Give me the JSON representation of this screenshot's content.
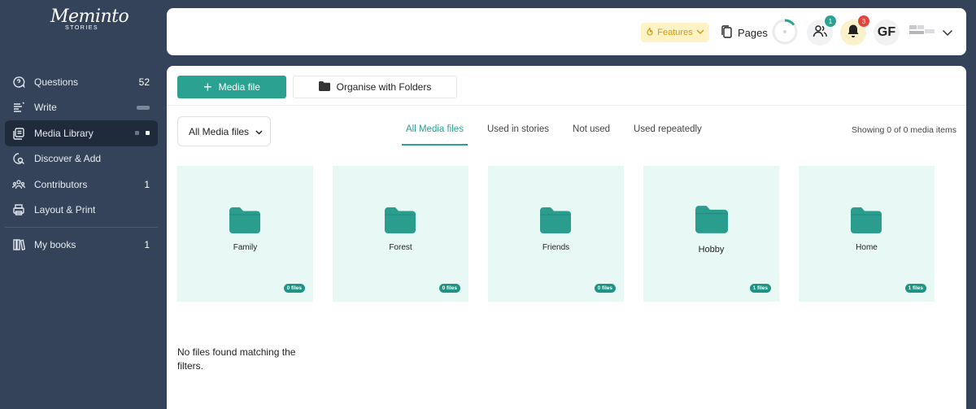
{
  "brand": {
    "logo_script": "Meminto",
    "logo_sub": "STORIES"
  },
  "sidebar": {
    "items": [
      {
        "label": "Questions",
        "count": "52",
        "icon": "chat-question-icon"
      },
      {
        "label": "Write",
        "count": "",
        "icon": "write-icon"
      },
      {
        "label": "Media Library",
        "count": "",
        "icon": "media-library-icon"
      },
      {
        "label": "Discover & Add",
        "count": "",
        "icon": "discover-icon"
      },
      {
        "label": "Contributors",
        "count": "1",
        "icon": "contributors-icon"
      },
      {
        "label": "Layout & Print",
        "count": "",
        "icon": "printer-icon"
      },
      {
        "label": "My books",
        "count": "1",
        "icon": "books-icon"
      }
    ]
  },
  "header": {
    "features_label": "Features",
    "pages_label": "Pages",
    "contributors_badge": "1",
    "notifications_badge": "3",
    "avatar_initials": "GF",
    "colors": {
      "teal": "#2aa191",
      "badge_red": "#e2453c",
      "features_bg": "#fdf3c7"
    }
  },
  "toolbar": {
    "media_file_label": "Media file",
    "organise_label": "Organise with Folders"
  },
  "filters": {
    "selected": "All Media files",
    "tabs": [
      "All Media files",
      "Used in stories",
      "Not used",
      "Used repeatedly"
    ],
    "active_tab": "All Media files",
    "showing": "Showing 0 of 0 media items"
  },
  "folders": [
    {
      "name": "Family",
      "count": "0 files"
    },
    {
      "name": "Forest",
      "count": "0 files"
    },
    {
      "name": "Friends",
      "count": "0 files"
    },
    {
      "name": "Hobby",
      "count": "1 files"
    },
    {
      "name": "Home",
      "count": "1 files"
    }
  ],
  "empty_message": "No files found matching the filters."
}
